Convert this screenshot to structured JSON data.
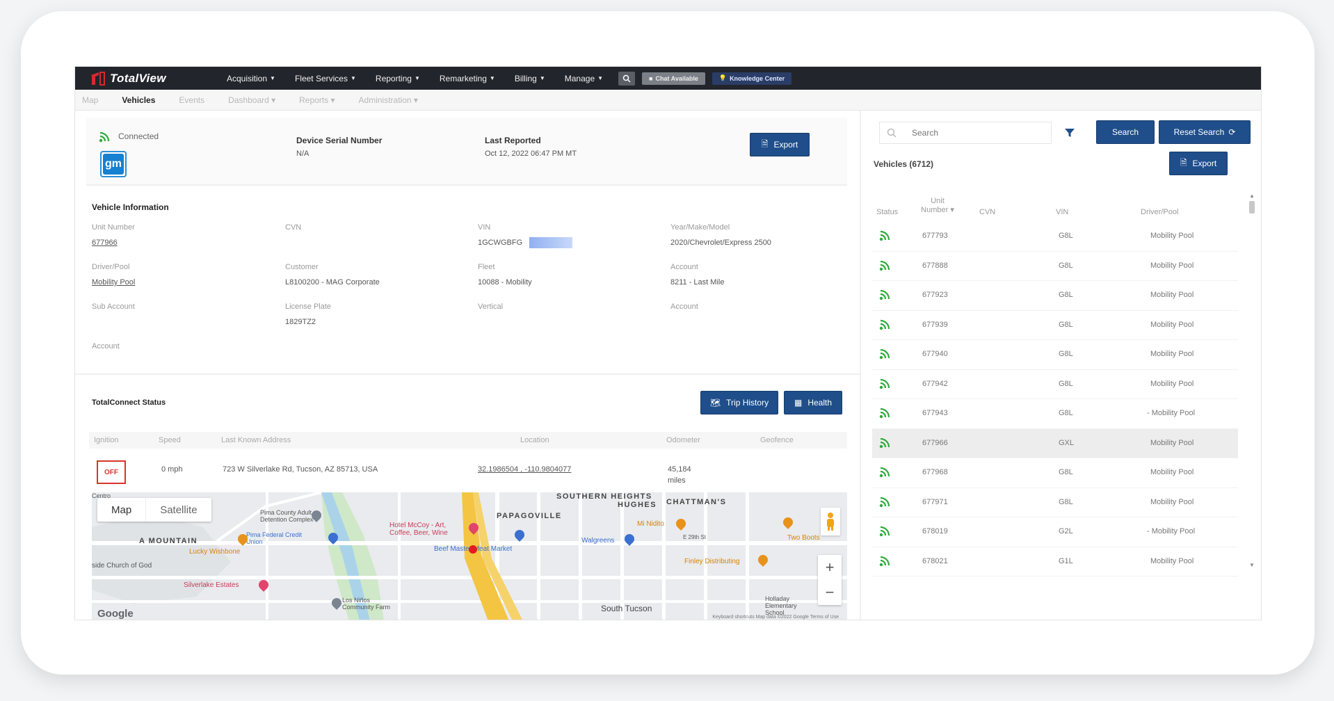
{
  "app": {
    "brand": "TotalView"
  },
  "topnav": {
    "items": [
      {
        "label": "Acquisition"
      },
      {
        "label": "Fleet Services"
      },
      {
        "label": "Reporting"
      },
      {
        "label": "Remarketing"
      },
      {
        "label": "Billing"
      },
      {
        "label": "Manage"
      }
    ],
    "chat_label": "Chat Available",
    "knowledge_label": "Knowledge Center"
  },
  "subnav": {
    "items": [
      {
        "label": "Map",
        "active": false
      },
      {
        "label": "Vehicles",
        "active": true
      },
      {
        "label": "Events",
        "active": false
      },
      {
        "label": "Dashboard ▾",
        "active": false
      },
      {
        "label": "Reports ▾",
        "active": false
      },
      {
        "label": "Administration ▾",
        "active": false
      }
    ]
  },
  "device": {
    "connection": "Connected",
    "brand_badge": "gm",
    "serial_label": "Device Serial Number",
    "serial_value": "N/A",
    "reported_label": "Last Reported",
    "reported_value": "Oct 12, 2022 06:47 PM MT",
    "export_label": "Export"
  },
  "vehicle_info": {
    "title": "Vehicle Information",
    "unit_number_label": "Unit Number",
    "unit_number": "677966",
    "cvn_label": "CVN",
    "vin_label": "VIN",
    "vin": "1GCWGBFG",
    "ymm_label": "Year/Make/Model",
    "ymm": "2020/Chevrolet/Express 2500",
    "driver_label": "Driver/Pool",
    "driver": "Mobility Pool",
    "customer_label": "Customer",
    "customer": "L8100200 - MAG Corporate",
    "fleet_label": "Fleet",
    "fleet": "10088 - Mobility",
    "account_label": "Account",
    "account": "8211 - Last Mile",
    "sub_account_label": "Sub Account",
    "license_label": "License Plate",
    "license": "1829TZ2",
    "vertical_label": "Vertical",
    "account2_label": "Account",
    "account3_label": "Account"
  },
  "totalconnect": {
    "title": "TotalConnect Status",
    "trip_history_label": "Trip History",
    "health_label": "Health",
    "headers": {
      "ignition": "Ignition",
      "speed": "Speed",
      "address": "Last Known Address",
      "location": "Location",
      "odometer": "Odometer",
      "geofence": "Geofence"
    },
    "ignition": "OFF",
    "speed": "0 mph",
    "address": "723 W Silverlake Rd, Tucson, AZ 85713, USA",
    "location": "32.1986504 , -110.9804077",
    "odometer": "45,184",
    "odometer_unit": "miles"
  },
  "map": {
    "tab_map": "Map",
    "tab_satellite": "Satellite",
    "zoom_in": "+",
    "zoom_out": "−",
    "google": "Google",
    "attribution": "Keyboard shortcuts   Map data ©2022 Google   Terms of Use",
    "labels": {
      "southern_heights": "SOUTHERN HEIGHTS",
      "hughes": "HUGHES",
      "chattmans": "CHATTMAN'S",
      "papagoville": "PAPAGOVILLE",
      "a_mountain": "A MOUNTAIN",
      "pima_detention": "Pima County Adult Detention Complex",
      "pima_credit": "Pima Federal Credit Union",
      "hotel_mccoy": "Hotel McCoy - Art, Coffee, Beer, Wine",
      "walgreens": "Walgreens",
      "mi_nidito": "Mi Nidito",
      "two_boots": "Two Boots",
      "lucky_wishbone": "Lucky Wishbone",
      "church": "side Church of God",
      "beef_market": "Beef Master Meat Market",
      "finley": "Finley Distributing",
      "silverlake": "Silverlake Estates",
      "los_ninos": "Los Niños Community Farm",
      "south_tucson": "South Tucson",
      "holladay": "Holladay Elementary School",
      "centro": "Centro",
      "e_29th": "E 29th St"
    }
  },
  "vehicles": {
    "search_placeholder": "Search",
    "search_label": "Search",
    "reset_label": "Reset Search",
    "count_label": "Vehicles (6712)",
    "export_label": "Export",
    "headers": {
      "status": "Status",
      "unit": "Unit Number ▾",
      "cvn": "CVN",
      "vin": "VIN",
      "driver": "Driver/Pool"
    },
    "rows": [
      {
        "unit": "677793",
        "vin": "G8L",
        "driver": "Mobility Pool",
        "selected": false
      },
      {
        "unit": "677888",
        "vin": "G8L",
        "driver": "Mobility Pool",
        "selected": false
      },
      {
        "unit": "677923",
        "vin": "G8L",
        "driver": "Mobility Pool",
        "selected": false
      },
      {
        "unit": "677939",
        "vin": "G8L",
        "driver": "Mobility Pool",
        "selected": false
      },
      {
        "unit": "677940",
        "vin": "G8L",
        "driver": "Mobility Pool",
        "selected": false
      },
      {
        "unit": "677942",
        "vin": "G8L",
        "driver": "Mobility Pool",
        "selected": false
      },
      {
        "unit": "677943",
        "vin": "G8L",
        "driver": "- Mobility Pool",
        "selected": false
      },
      {
        "unit": "677966",
        "vin": "GXL",
        "driver": "Mobility Pool",
        "selected": true
      },
      {
        "unit": "677968",
        "vin": "G8L",
        "driver": "Mobility Pool",
        "selected": false
      },
      {
        "unit": "677971",
        "vin": "G8L",
        "driver": "Mobility Pool",
        "selected": false
      },
      {
        "unit": "678019",
        "vin": "G2L",
        "driver": "- Mobility Pool",
        "selected": false
      },
      {
        "unit": "678021",
        "vin": "G1L",
        "driver": "Mobility Pool",
        "selected": false
      }
    ]
  },
  "colors": {
    "primary": "#1f4e8a",
    "nav_bg": "#22252b",
    "connected_green": "#2eaa3a",
    "alert_red": "#d9342b"
  }
}
